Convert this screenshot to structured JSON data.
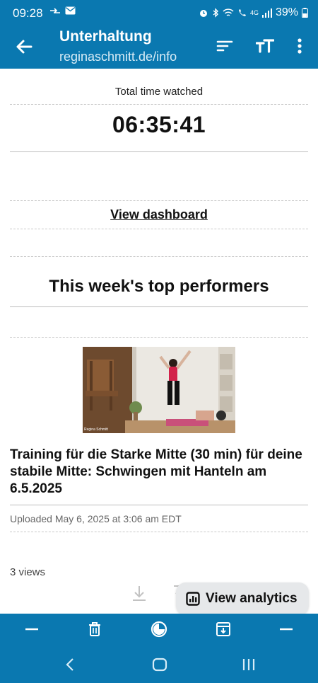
{
  "status": {
    "time": "09:28",
    "battery": "39%",
    "network": "4G"
  },
  "app_bar": {
    "title": "Unterhaltung",
    "subtitle": "reginaschmitt.de/info"
  },
  "stats": {
    "total_label": "Total time watched",
    "total_value": "06:35:41",
    "dashboard_link": "View dashboard"
  },
  "top": {
    "heading": "This week's top performers",
    "video": {
      "thumb_caption": "Regina Schmitt",
      "title": "Training für die Starke Mitte (30 min) für deine stabile Mitte: Schwingen mit Hanteln am 6.5.2025",
      "uploaded": "Uploaded May 6, 2025 at 3:06 am EDT",
      "views": "3 views"
    }
  },
  "fab": {
    "label": "View analytics"
  },
  "colors": {
    "brand": "#0a78b0",
    "fab_bg": "#e6e8ea"
  },
  "icons": {
    "bottom": [
      "minus-icon",
      "trash-icon",
      "circle-half-icon",
      "archive-icon",
      "minus-icon"
    ],
    "actions": [
      "sort-icon",
      "text-size-icon",
      "more-vert-icon"
    ]
  }
}
